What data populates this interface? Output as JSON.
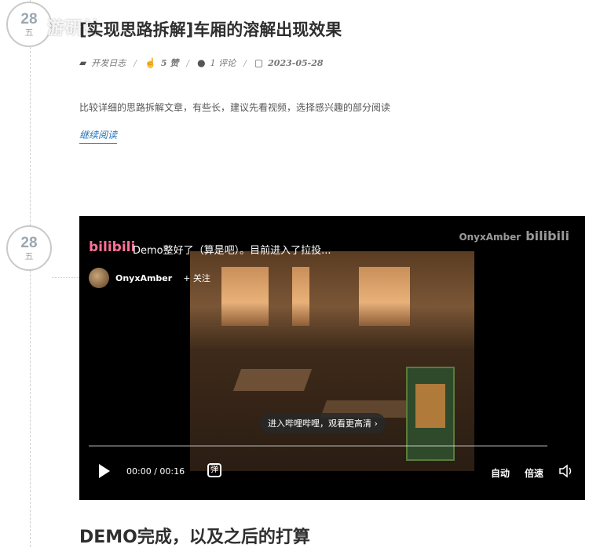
{
  "watermark": "游研社",
  "posts": [
    {
      "day": "28",
      "weekday": "五",
      "title": "[实现思路拆解]车厢的溶解出现效果",
      "meta": {
        "category": "开发日志",
        "likes": "5 赞",
        "comments": "1 评论",
        "date": "2023-05-28"
      },
      "excerpt": "比较详细的思路拆解文章，有些长，建议先看视频，选择感兴趣的部分阅读",
      "read_more": "继续阅读"
    },
    {
      "day": "28",
      "weekday": "五",
      "video": {
        "logo": "bilibili",
        "title": "Demo整好了（算是吧）。目前进入了拉投...",
        "brand": "OnyxAmber",
        "brand_logo": "bilibili",
        "uploader": "OnyxAmber",
        "follow": "+ 关注",
        "hd_tip": "进入哔哩哔哩，观看更高清 ›",
        "time": "00:00 / 00:16",
        "danmaku": "弹",
        "auto": "自动",
        "speed": "倍速",
        "progress": 0.0
      },
      "section_title": "DEMO完成，以及之后的打算"
    }
  ],
  "icons": {
    "folder": "folder-open-icon",
    "like": "thumbs-up-icon",
    "comment": "comment-icon",
    "calendar": "calendar-icon"
  },
  "colors": {
    "link": "#1e73be",
    "bilibili_pink": "#fb7299",
    "progress": "#00a1d6"
  }
}
